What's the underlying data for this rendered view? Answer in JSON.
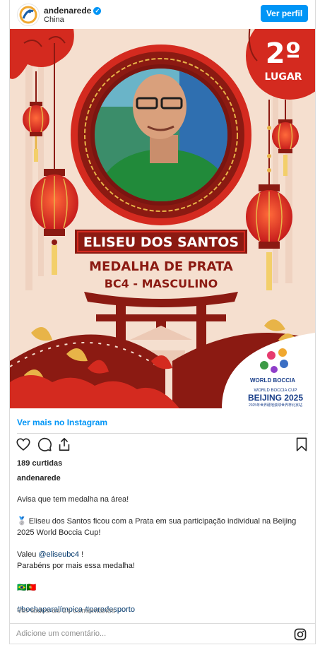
{
  "post": {
    "username": "andenarede",
    "location": "China",
    "follow_label": "Ver perfil",
    "view_more": "Ver mais no Instagram",
    "likes": "189 curtidas",
    "caption_username": "andenarede",
    "caption": {
      "line1": "Avisa que tem medalha na área!",
      "medal_emoji": "🥈",
      "line2": "Eliseu dos Santos ficou com a Prata em sua participação individual na Beijing 2025 World Boccia Cup!",
      "line3_prefix": "Valeu ",
      "mention": "@eliseubc4",
      "line3_suffix": " !",
      "line4": "Parabéns por mais essa medalha!",
      "flags": "🇧🇷🇵🇹",
      "hashtags": "#bochaparalímpica #paradesporto"
    },
    "comments_link": "Ver todos os 24 comentários",
    "comment_placeholder": "Adicione um comentário..."
  },
  "poster": {
    "place_number": "2º",
    "place_label": "LUGAR",
    "athlete_name": "ELISEU DOS SANTOS",
    "medal": "MEDALHA DE PRATA",
    "category": "BC4 - MASCULINO",
    "logo_name": "WORLD BOCCIA",
    "event_small": "WORLD BOCCIA CUP",
    "event_city": "BEIJING 2025",
    "event_cn": "2025年世界硬地滚球世界杯北京站"
  },
  "colors": {
    "accent": "#0095f6",
    "poster_bg": "#f5dfcf",
    "poster_red": "#d42a1f",
    "dark_red": "#8b1a12",
    "gold": "#e8b448"
  },
  "icons": [
    "heart-icon",
    "comment-icon",
    "share-icon",
    "bookmark-icon",
    "instagram-icon",
    "verified-badge-icon"
  ]
}
